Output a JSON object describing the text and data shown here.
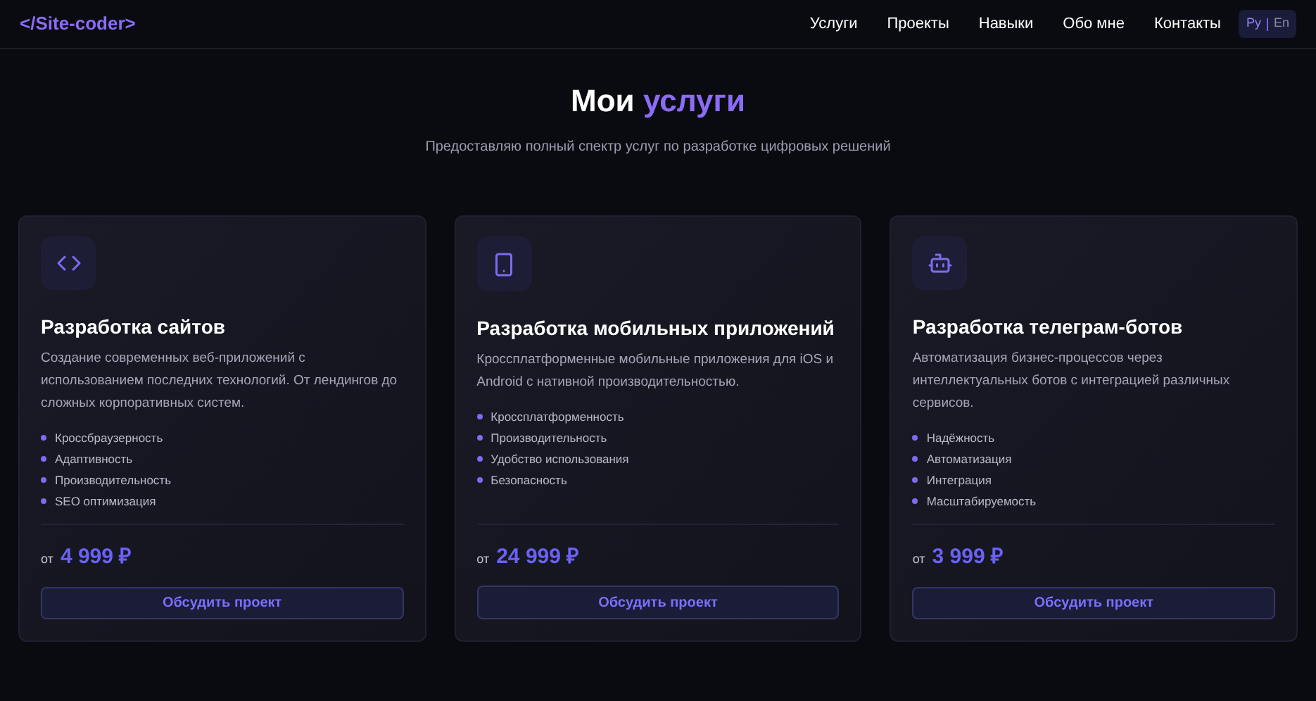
{
  "header": {
    "logo": "</Site-coder>",
    "nav": [
      {
        "label": "Услуги"
      },
      {
        "label": "Проекты"
      },
      {
        "label": "Навыки"
      },
      {
        "label": "Обо мне"
      },
      {
        "label": "Контакты"
      }
    ],
    "languages": [
      {
        "label": "Ру",
        "selected": true
      },
      {
        "label": "En",
        "selected": false
      }
    ]
  },
  "section": {
    "title": "Мои",
    "title_accent": "услуги",
    "subtitle": "Предоставляю полный спектр услуг по разработке цифровых решений"
  },
  "cards": [
    {
      "kind": "code",
      "title": "Разработка сайтов",
      "description": "Создание современных веб-приложений с использованием последних технологий. От лендингов до сложных корпоративных систем.",
      "features": [
        "Кроссбраузерность",
        "Адаптивность",
        "Производительность",
        "SEO оптимизация"
      ],
      "price_prefix": "от",
      "price": "4 999 ₽",
      "button": "Обсудить проект"
    },
    {
      "kind": "phone",
      "title": "Разработка мобильных приложений",
      "description": "Кроссплатформенные мобильные приложения для iOS и Android с нативной производительностью.",
      "features": [
        "Кроссплатформенность",
        "Производительность",
        "Удобство использования",
        "Безопасность"
      ],
      "price_prefix": "от",
      "price": "24 999 ₽",
      "button": "Обсудить проект"
    },
    {
      "kind": "bot",
      "title": "Разработка телеграм-ботов",
      "description": "Автоматизация бизнес-процессов через интеллектуальных ботов с интеграцией различных сервисов.",
      "features": [
        "Надёжность",
        "Автоматизация",
        "Интеграция",
        "Масштабируемость"
      ],
      "price_prefix": "от",
      "price": "3 999 ₽",
      "button": "Обсудить проект"
    }
  ]
}
